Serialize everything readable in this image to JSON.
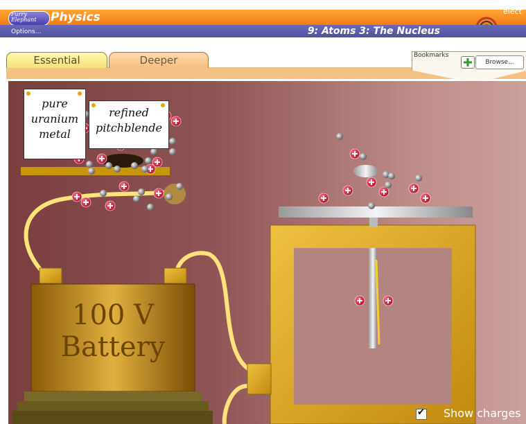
{
  "header": {
    "logo_text": "Furry Elephant",
    "app_title": "Physics",
    "corner_label": "elect",
    "options_label": "Options...",
    "chapter_title": "9: Atoms 3: The Nucleus"
  },
  "tabs": [
    {
      "label": "Essential"
    },
    {
      "label": "Deeper"
    }
  ],
  "bookmarks": {
    "label": "Bookmarks",
    "add_icon": "plus-icon",
    "browse_label": "Browse..."
  },
  "stage": {
    "sign_uranium": [
      "pure",
      "uranium",
      "metal"
    ],
    "sign_pitchblende": [
      "refined",
      "pitchblende"
    ],
    "battery_lines": [
      "100 V",
      "Battery"
    ],
    "show_charges_label": "Show charges",
    "show_charges_checked": true
  },
  "colors": {
    "header_orange": "#f07d12",
    "nav_blue": "#50519d",
    "stage_dark": "#7a3e3f",
    "stage_light": "#caa09c",
    "gold": "#d4a017",
    "wire": "#ffe37a",
    "proton": "#d81c3c"
  }
}
